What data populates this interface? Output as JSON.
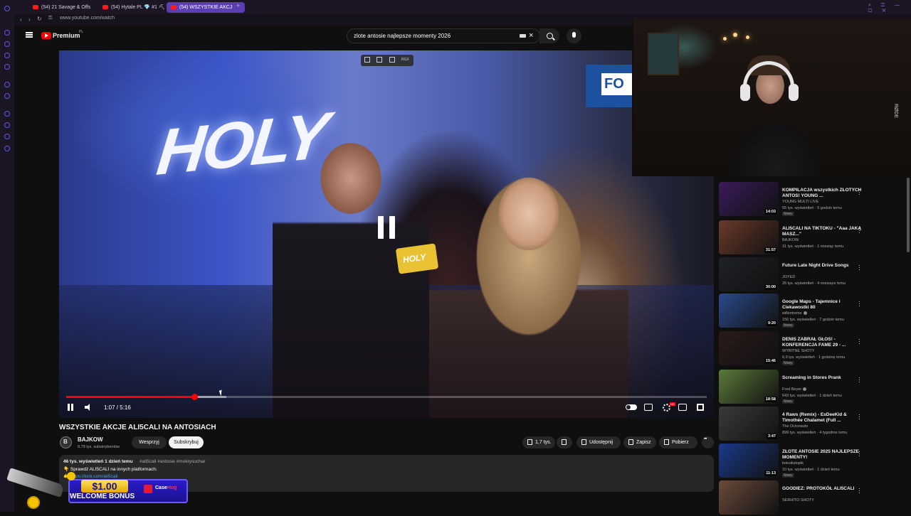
{
  "browser": {
    "tabs": [
      {
        "label": "(54) 21 Savage & Offs"
      },
      {
        "label": "(54) Hytale PL 💎 #1 ⛏ "
      },
      {
        "label": "(54) WSZYSTKIE AKCJ"
      }
    ],
    "new_tab": "+",
    "url": "www.youtube.com/watch"
  },
  "youtube": {
    "brand": "Premium",
    "brand_region": "PL",
    "search_value": "zlote antosie najlepsze momenty 2026",
    "clear_icon": "×"
  },
  "player": {
    "video_overlay_sign": "HOLY",
    "video_overlay_fo": "FO",
    "mic_flag": "HOLY",
    "tool_label": "RGX",
    "time": "1:07 / 5:16",
    "progress": 0.2,
    "buffered": 0.25
  },
  "video": {
    "title": "WSZYSTKIE AKCJE ALI5CALI NA ANTOSIACH",
    "channel_initial": "B",
    "channel": "BAJKOW",
    "subscribers": "8,79 tys. subskrybentów",
    "support_label": "Wesprzyj",
    "subscribe_label": "Subskrybuj",
    "likes": "1,7 tys.",
    "share_label": "Udostępnij",
    "save_label": "Zapisz",
    "download_label": "Pobierz"
  },
  "description": {
    "meta": "46 tys. wyświetleń  1 dzień temu",
    "tags": "#ali5cali #antosie #mokrysuchar",
    "line1": "👇 Sprawdź ALI5CALI na innych platformach:",
    "line2": "👉 https://kick.com/ali5cali"
  },
  "ad": {
    "amount": "$1.00",
    "bonus": "WELCOME BONUS",
    "brand_a": "Case",
    "brand_b": "Hug"
  },
  "webcam": {
    "mic_text": "RØDE"
  },
  "recommended": [
    {
      "title": "KOMPILACJA wszystkich ZŁOTYCH ANTOS! YOUNG ...",
      "channel": "YOUNG MULTI LIVE",
      "verified": false,
      "meta": "55 tys. wyświetleń · 5 godzin temu",
      "badge": "Nowy",
      "duration": "14:03",
      "thumb": "#3a1a5a"
    },
    {
      "title": "ALI5CALI NA TIKTOKU - \"Aaa JAKĄ MASZ...\"",
      "channel": "BAJKOW",
      "verified": false,
      "meta": "31 tys. wyświetleń · 1 miesiąc temu",
      "badge": "",
      "duration": "31:57",
      "thumb": "#6a3a2a"
    },
    {
      "title": "Future Late Night Drive Songs",
      "channel": "JOYED",
      "verified": false,
      "meta": "26 tys. wyświetleń · 4 miesiące temu",
      "badge": "",
      "duration": "30:00",
      "thumb": "#1e2126"
    },
    {
      "title": "Google Maps - Tajemnice i Ciekawostki 80",
      "channel": "willextreme",
      "verified": true,
      "meta": "156 tys. wyświetleń · 7 godzin temu",
      "badge": "Nowy",
      "duration": "9:20",
      "thumb": "#2a4a8a"
    },
    {
      "title": "DENIS ZABRAŁ GŁOS! - KONFERENCJA FAME 29 - ...",
      "channel": "WYBITNE SHOTY",
      "verified": false,
      "meta": "6,9 tys. wyświetleń · 1 godzinę temu",
      "badge": "Nowy",
      "duration": "15:46",
      "thumb": "#2a1a1a"
    },
    {
      "title": "Screaming in Stores Prank",
      "channel": "Fred Beyer",
      "verified": true,
      "meta": "643 tys. wyświetleń · 1 dzień temu",
      "badge": "Nowy",
      "duration": "18:58",
      "thumb": "#5a7a3a"
    },
    {
      "title": "4 Raws (Remix) - EsDeeKid & Timothée Chalamet (Full ...",
      "channel": "The Octonauts",
      "verified": false,
      "meta": "899 tys. wyświetleń · 4 tygodnie temu",
      "badge": "",
      "duration": "3:47",
      "thumb": "#3a3a3a"
    },
    {
      "title": "ZŁOTE ANTOSIE 2025 NAJLEPSZE MOMENTY!",
      "channel": "boksikstopik",
      "verified": false,
      "meta": "10 tys. wyświetleń · 1 dzień temu",
      "badge": "Nowy",
      "duration": "11:13",
      "thumb": "#1a3a8a"
    },
    {
      "title": "GOODIEZ: PROTOKÓŁ ALI5CALI",
      "channel": "SERHITO SHOTY",
      "verified": false,
      "meta": "",
      "badge": "",
      "duration": "",
      "thumb": "#6a4a3a"
    }
  ]
}
